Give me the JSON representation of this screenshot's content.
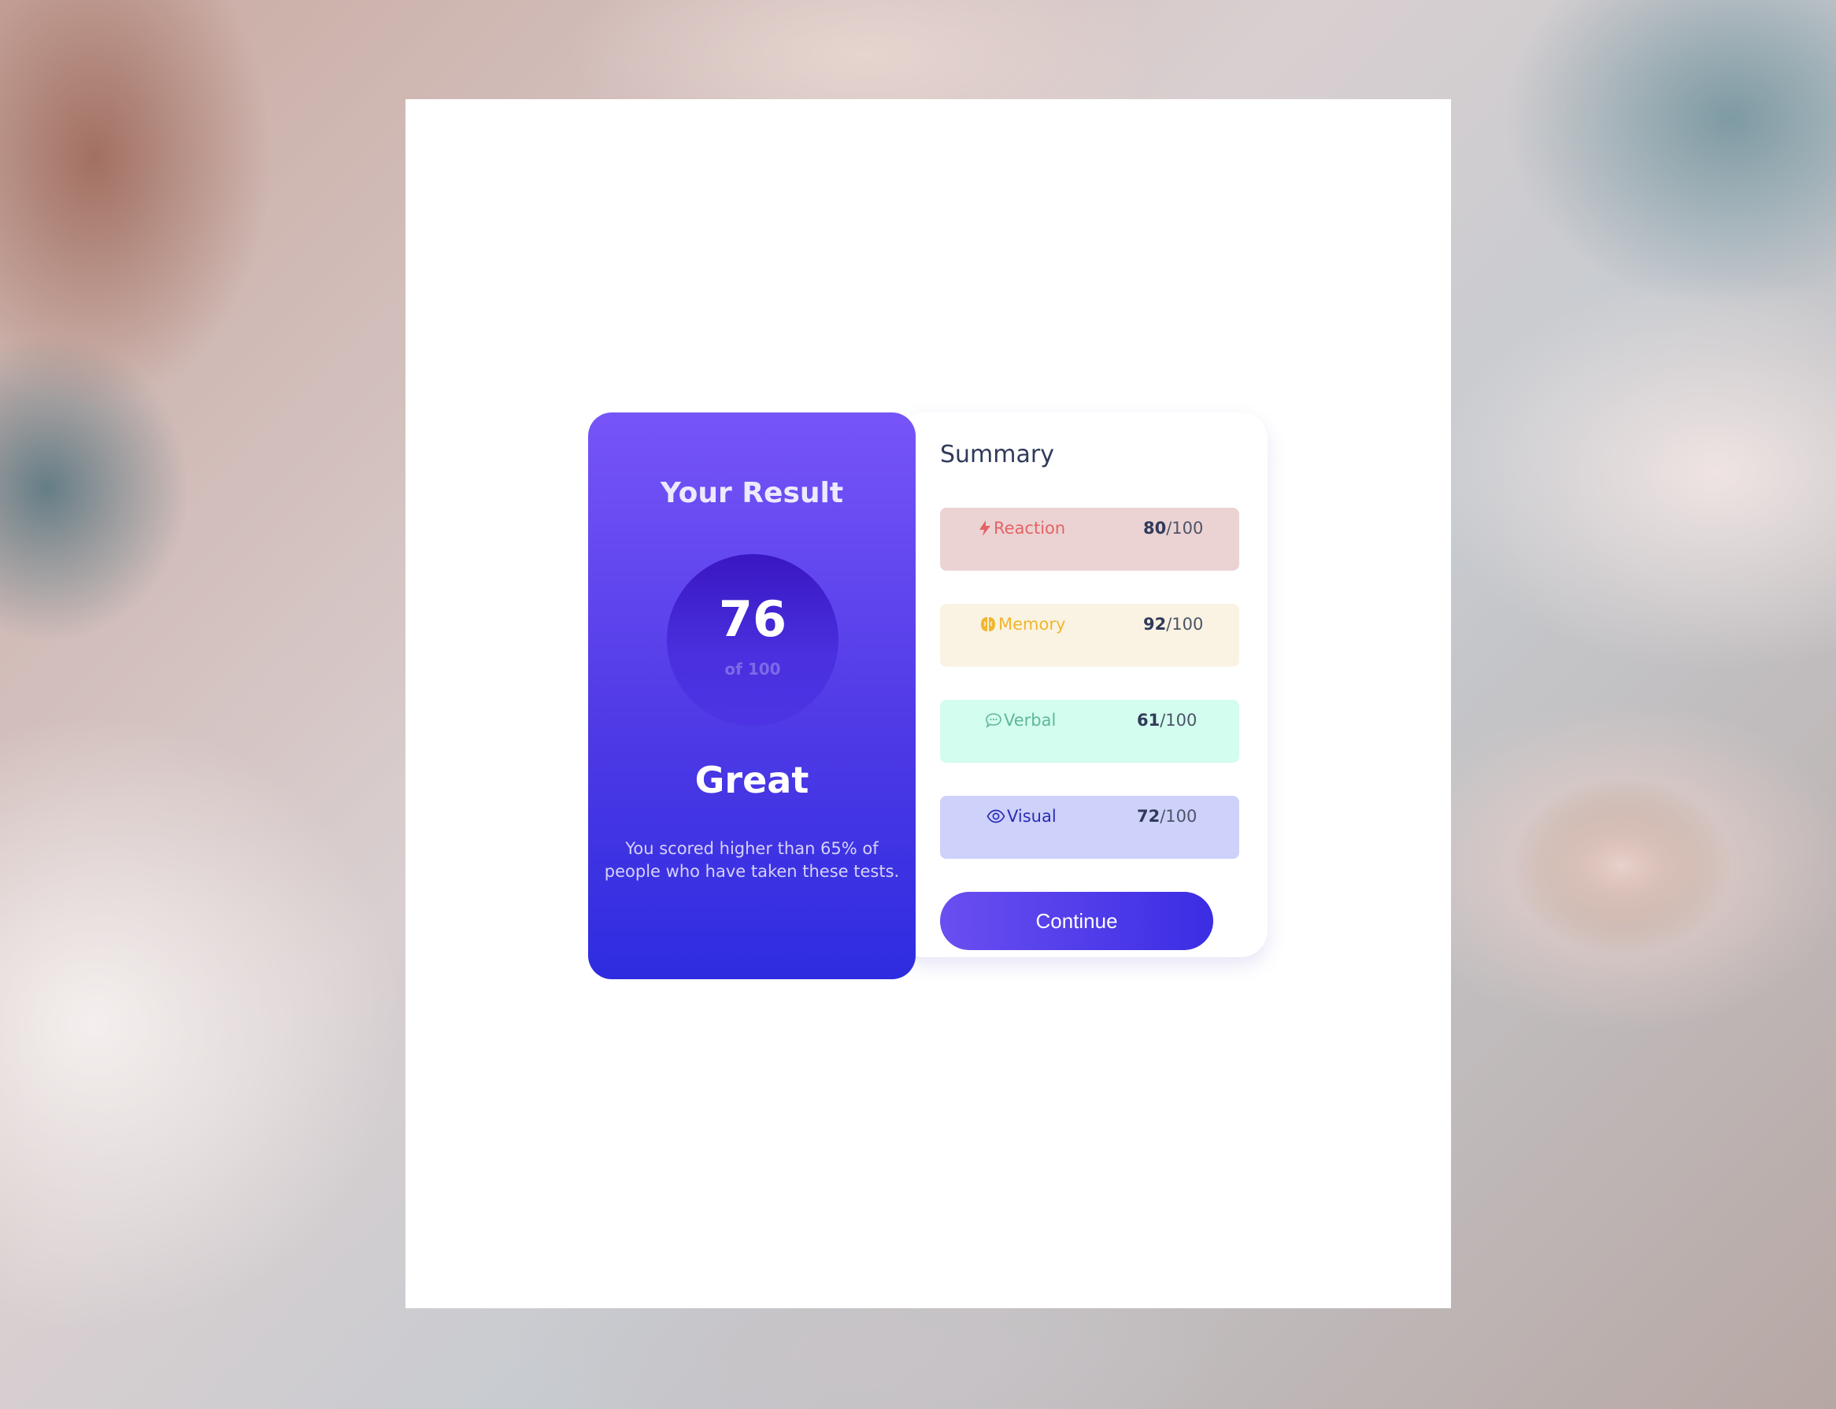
{
  "result": {
    "title": "Your Result",
    "score": "76",
    "score_of": "of 100",
    "grade": "Great",
    "description": "You scored higher than 65% of people who have taken these tests."
  },
  "summary": {
    "title": "Summary",
    "items": [
      {
        "label": "Reaction",
        "score": "80",
        "max": "/100",
        "icon": "lightning-icon",
        "color": "#e36365",
        "bg": "#ecd3d3"
      },
      {
        "label": "Memory",
        "score": "92",
        "max": "/100",
        "icon": "brain-icon",
        "color": "#f0b62d",
        "bg": "#faf3e3"
      },
      {
        "label": "Verbal",
        "score": "61",
        "max": "/100",
        "icon": "speech-bubble-icon",
        "color": "#5fb79a",
        "bg": "#d3fdee"
      },
      {
        "label": "Visual",
        "score": "72",
        "max": "/100",
        "icon": "eye-icon",
        "color": "#2a2cb6",
        "bg": "#ced1fa"
      }
    ],
    "continue_label": "Continue"
  }
}
